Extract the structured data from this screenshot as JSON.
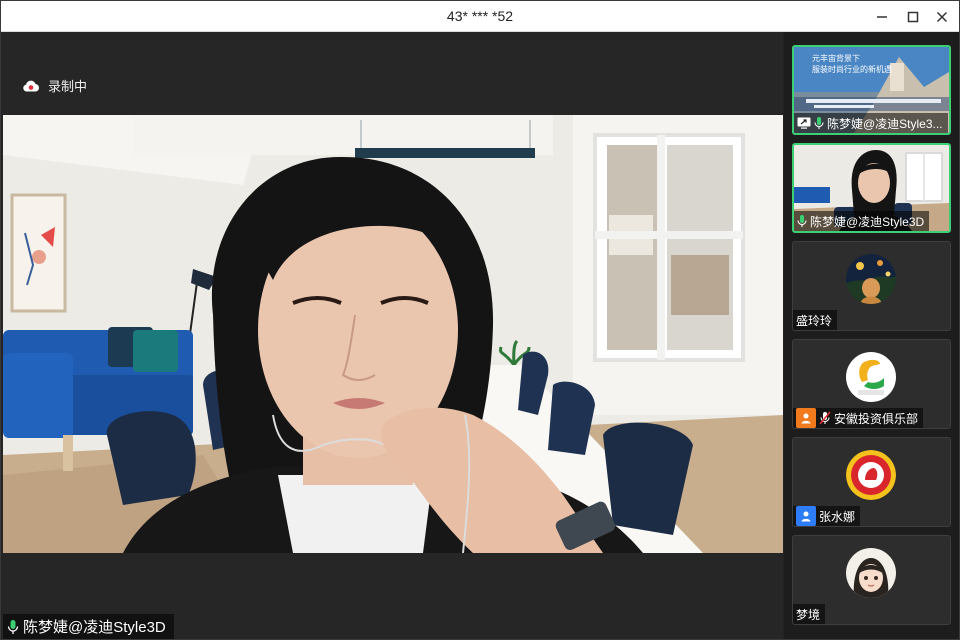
{
  "window": {
    "title": "43* *** *52"
  },
  "recording": {
    "label": "录制中"
  },
  "main_speaker": {
    "name": "陈梦婕@凌迪Style3D"
  },
  "participants": [
    {
      "name": "陈梦婕@凌迪Style3...",
      "type": "screen-share",
      "active": true
    },
    {
      "name": "陈梦婕@凌迪Style3D",
      "type": "video",
      "active": true
    },
    {
      "name": "盛玲玲",
      "type": "avatar"
    },
    {
      "name": "安徽投资俱乐部",
      "type": "avatar",
      "badge_color": "#f07a1c"
    },
    {
      "name": "张水娜",
      "type": "avatar",
      "badge_color": "#2f7df6"
    },
    {
      "name": "梦境",
      "type": "avatar"
    }
  ],
  "share_thumb": {
    "line1": "元丰宙背景下",
    "line2": "服装时尚行业的新机遇"
  },
  "colors": {
    "active_border": "#3ccf74",
    "mic_green": "#3ccf74",
    "mic_muted": "#e0303a",
    "recording_red": "#e0303a"
  }
}
